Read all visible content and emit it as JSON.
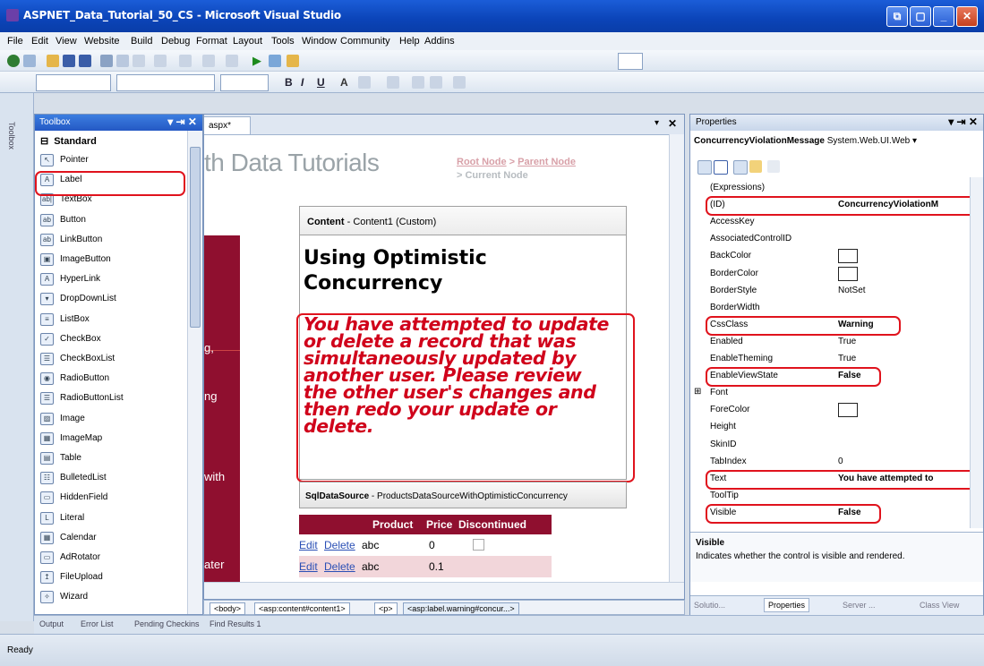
{
  "window": {
    "title": "ASPNET_Data_Tutorial_50_CS - Microsoft Visual Studio"
  },
  "menu": [
    "File",
    "Edit",
    "View",
    "Website",
    "Build",
    "Debug",
    "Format",
    "Layout",
    "Tools",
    "Window",
    "Community",
    "Help",
    "Addins"
  ],
  "format_toolbar": {
    "bold": "B",
    "italic": "I",
    "underline": "U",
    "font_color": "A"
  },
  "toolbox": {
    "title": "Toolbox",
    "strip_label": "Toolbox",
    "section": "Standard",
    "items": [
      {
        "label": "Pointer",
        "icon": "pointer-icon",
        "glyph": "↖"
      },
      {
        "label": "Label",
        "icon": "label-icon",
        "glyph": "A"
      },
      {
        "label": "TextBox",
        "icon": "textbox-icon",
        "glyph": "ab|"
      },
      {
        "label": "Button",
        "icon": "button-icon",
        "glyph": "ab"
      },
      {
        "label": "LinkButton",
        "icon": "linkbutton-icon",
        "glyph": "ab"
      },
      {
        "label": "ImageButton",
        "icon": "imagebutton-icon",
        "glyph": "▣"
      },
      {
        "label": "HyperLink",
        "icon": "hyperlink-icon",
        "glyph": "A"
      },
      {
        "label": "DropDownList",
        "icon": "dropdownlist-icon",
        "glyph": "▾"
      },
      {
        "label": "ListBox",
        "icon": "listbox-icon",
        "glyph": "≡"
      },
      {
        "label": "CheckBox",
        "icon": "checkbox-icon",
        "glyph": "✓"
      },
      {
        "label": "CheckBoxList",
        "icon": "checkboxlist-icon",
        "glyph": "☰"
      },
      {
        "label": "RadioButton",
        "icon": "radiobutton-icon",
        "glyph": "◉"
      },
      {
        "label": "RadioButtonList",
        "icon": "radiobuttonlist-icon",
        "glyph": "☰"
      },
      {
        "label": "Image",
        "icon": "image-icon",
        "glyph": "▨"
      },
      {
        "label": "ImageMap",
        "icon": "imagemap-icon",
        "glyph": "▦"
      },
      {
        "label": "Table",
        "icon": "table-icon",
        "glyph": "▤"
      },
      {
        "label": "BulletedList",
        "icon": "bulletedlist-icon",
        "glyph": "☷"
      },
      {
        "label": "HiddenField",
        "icon": "hiddenfield-icon",
        "glyph": "▭"
      },
      {
        "label": "Literal",
        "icon": "literal-icon",
        "glyph": "L"
      },
      {
        "label": "Calendar",
        "icon": "calendar-icon",
        "glyph": "▦"
      },
      {
        "label": "AdRotator",
        "icon": "adrotator-icon",
        "glyph": "▭"
      },
      {
        "label": "FileUpload",
        "icon": "fileupload-icon",
        "glyph": "↥"
      },
      {
        "label": "Wizard",
        "icon": "wizard-icon",
        "glyph": "✧"
      }
    ]
  },
  "designer": {
    "tab_label": "aspx*",
    "header_title": "th Data Tutorials",
    "breadcrumb_root": "Root Node",
    "breadcrumb_sep": " > ",
    "breadcrumb_parent": "Parent Node",
    "breadcrumb_current": "> Current Node",
    "content_label_bold": "Content",
    "content_label_rest": " - Content1 (Custom)",
    "heading": "Using Optimistic Concurrency",
    "warning_text": "You have attempted to update or delete a record that was simultaneously updated by another user. Please review the other user's changes and then redo your update or delete.",
    "sql_label_bold": "SqlDataSource",
    "sql_label_rest": " - ProductsDataSourceWithOptimisticConcurrency",
    "left_fragments": [
      "g,",
      "ng",
      "with",
      "ater"
    ],
    "grid_headers": [
      "Product",
      "Price",
      "Discontinued"
    ],
    "grid_rows": [
      {
        "edit": "Edit",
        "delete": "Delete",
        "product": "abc",
        "price": "0"
      },
      {
        "edit": "Edit",
        "delete": "Delete",
        "product": "abc",
        "price": "0.1"
      }
    ]
  },
  "breadcrumb_tags": [
    "<body>",
    "<asp:content#content1>",
    "<p>",
    "<asp:label.warning#concur...>"
  ],
  "properties": {
    "title": "Properties",
    "object_name": "ConcurrencyViolationMessage",
    "object_type": "System.Web.UI.Web",
    "rows": [
      {
        "name": "(Expressions)",
        "value": ""
      },
      {
        "name": "(ID)",
        "value": "ConcurrencyViolationM"
      },
      {
        "name": "AccessKey",
        "value": ""
      },
      {
        "name": "AssociatedControlID",
        "value": ""
      },
      {
        "name": "BackColor",
        "value": ""
      },
      {
        "name": "BorderColor",
        "value": ""
      },
      {
        "name": "BorderStyle",
        "value": "NotSet"
      },
      {
        "name": "BorderWidth",
        "value": ""
      },
      {
        "name": "CssClass",
        "value": "Warning"
      },
      {
        "name": "Enabled",
        "value": "True"
      },
      {
        "name": "EnableTheming",
        "value": "True"
      },
      {
        "name": "EnableViewState",
        "value": "False"
      },
      {
        "name": "Font",
        "value": ""
      },
      {
        "name": "ForeColor",
        "value": ""
      },
      {
        "name": "Height",
        "value": ""
      },
      {
        "name": "SkinID",
        "value": ""
      },
      {
        "name": "TabIndex",
        "value": "0"
      },
      {
        "name": "Text",
        "value": "You have attempted to"
      },
      {
        "name": "ToolTip",
        "value": ""
      },
      {
        "name": "Visible",
        "value": "False"
      }
    ],
    "desc_title": "Visible",
    "desc_text": "Indicates whether the control is visible and rendered.",
    "tabs": [
      "Solutio...",
      "Properties",
      "Server ...",
      "Class View"
    ]
  },
  "output_tabs": [
    "Output",
    "Error List",
    "Pending Checkins",
    "Find Results 1"
  ],
  "status": "Ready",
  "colors": {
    "accent": "#e0131d",
    "crimson": "#8f0f2f",
    "warning_text": "#d0021b"
  }
}
